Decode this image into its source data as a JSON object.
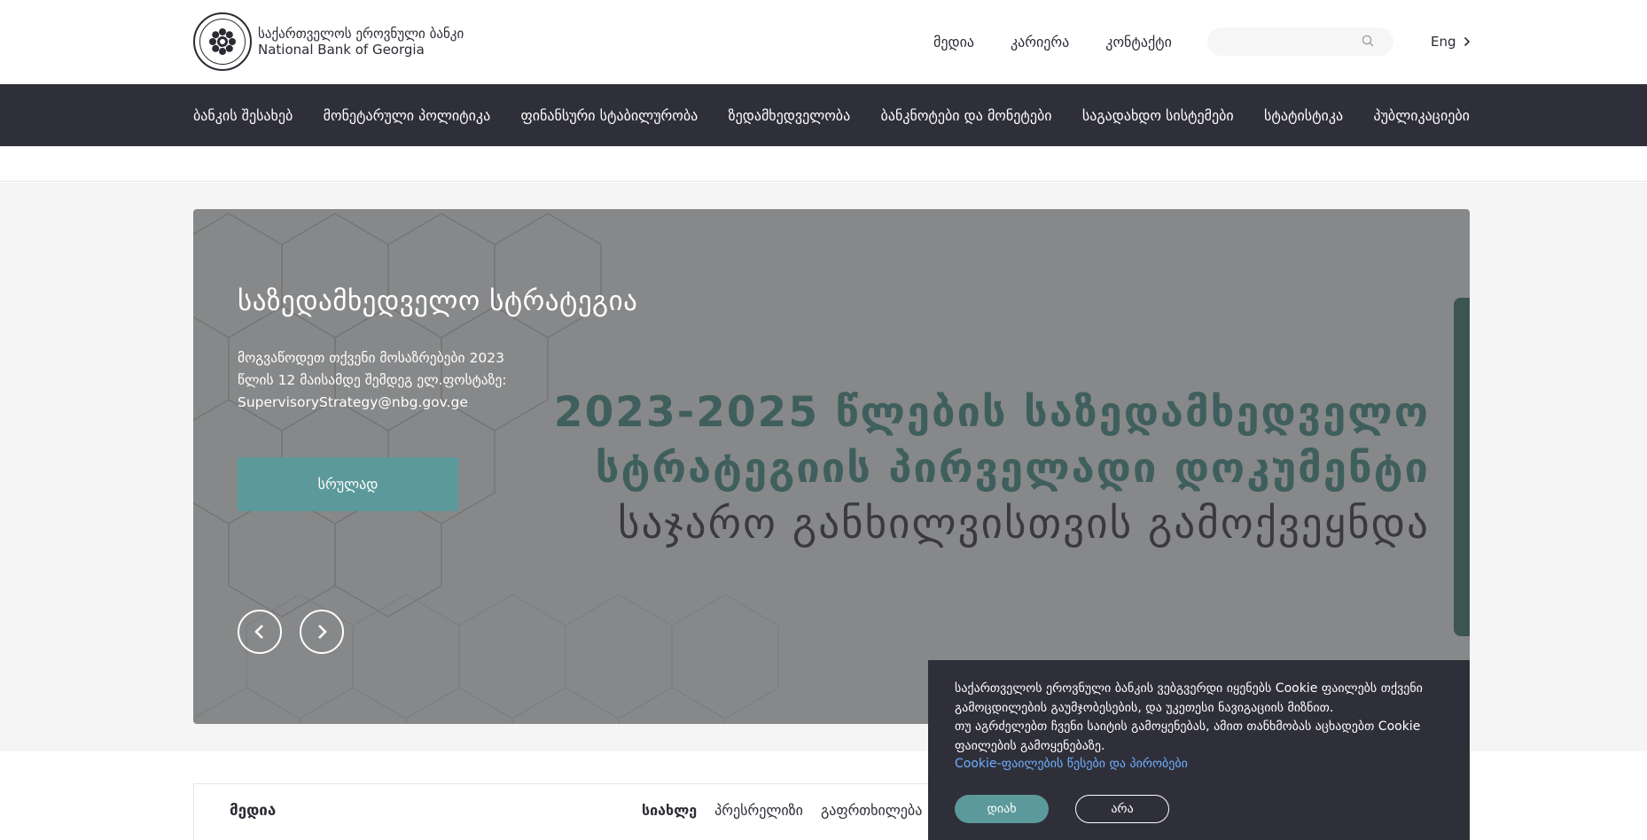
{
  "header": {
    "brand_line1": "საქართველოს ეროვნული ბანკი",
    "brand_line2": "National Bank of Georgia",
    "links": [
      "მედია",
      "კარიერა",
      "კონტაქტი"
    ],
    "search_placeholder": "",
    "language": "Eng"
  },
  "nav": {
    "items": [
      "ბანკის შესახებ",
      "მონეტარული პოლიტიკა",
      "ფინანსური სტაბილურობა",
      "ზედამხედველობა",
      "ბანკნოტები და მონეტები",
      "საგადახდო სისტემები",
      "სტატისტიკა",
      "პუბლიკაციები"
    ]
  },
  "slide": {
    "title": "საზედამხედველო სტრატეგია",
    "text_line1": "მოგვაწოდეთ თქვენი მოსაზრებები 2023",
    "text_line2": "წლის 12 მაისამდე შემდეგ ელ.ფოსტაზე:",
    "text_line3": "SupervisoryStrategy@nbg.gov.ge",
    "button": "სრულად",
    "banner_line1": "2023-2025 წლების საზედამხედველო",
    "banner_line2": "სტრატეგიის პირველადი დოკუმენტი",
    "banner_line3": "საჯარო განხილვისთვის გამოქვეყნდა"
  },
  "media": {
    "title": "მედია",
    "tabs": [
      "სიახლე",
      "პრესრელიზი",
      "გაფრთხილება"
    ]
  },
  "cookie": {
    "line1": "საქართველოს ეროვნული ბანკის ვებგვერდი იყენებს Cookie ფაილებს თქვენი",
    "line2": "გამოცდილების გაუმჯობესების, და უკეთესი ნავიგაციის მიზნით.",
    "line3": "თუ აგრძელებთ ჩვენი საიტის გამოყენებას, ამით თანხმობას აცხადებთ Cookie",
    "line4": "ფაილების გამოყენებაზე.",
    "link": "Cookie-ფაილების წესები და პირობები",
    "accept": "დიახ",
    "decline": "არა"
  },
  "colors": {
    "nav_bg": "#2f2f3a",
    "accent": "#5c999a",
    "slide_bg": "#878889",
    "banner_text": "#3f5f5d",
    "link": "#6fb0ff"
  }
}
